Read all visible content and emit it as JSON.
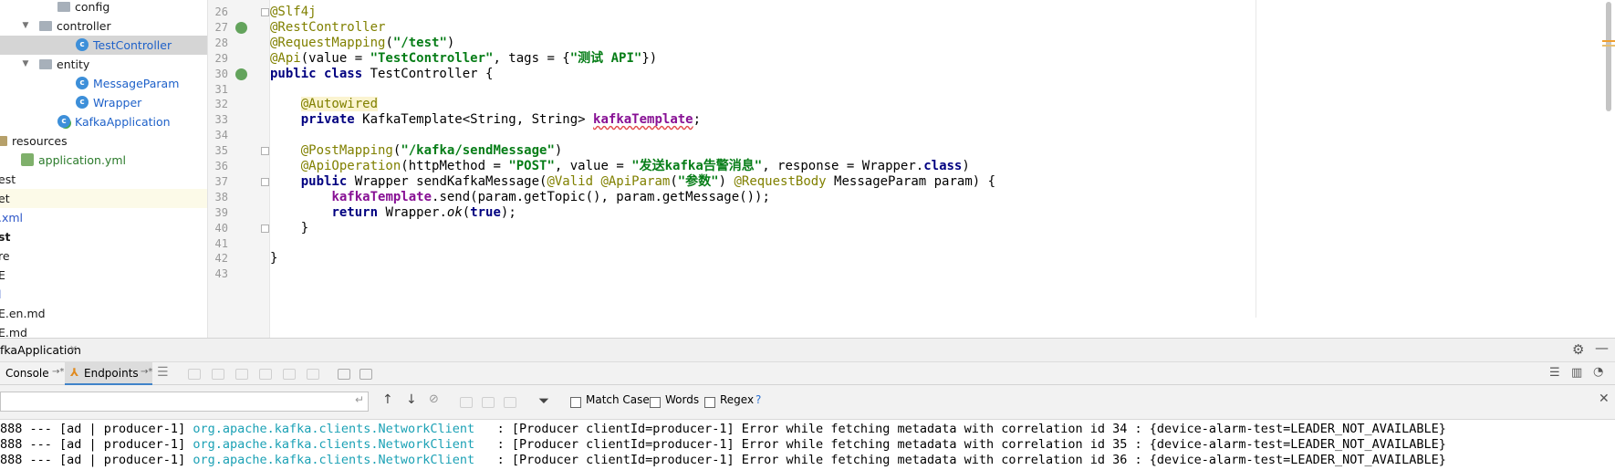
{
  "tree": [
    {
      "label": "config",
      "kind": "folder",
      "expanded": false,
      "depth": 3
    },
    {
      "label": "controller",
      "kind": "folder",
      "expanded": true,
      "depth": 2
    },
    {
      "label": "TestController",
      "kind": "class",
      "selected": true,
      "depth": 4
    },
    {
      "label": "entity",
      "kind": "folder",
      "expanded": true,
      "depth": 2
    },
    {
      "label": "MessageParam",
      "kind": "class",
      "depth": 4
    },
    {
      "label": "Wrapper",
      "kind": "class",
      "depth": 4
    },
    {
      "label": "KafkaApplication",
      "kind": "app",
      "depth": 3
    },
    {
      "label": "resources",
      "kind": "resfolder",
      "depth": 0
    },
    {
      "label": "application.yml",
      "kind": "yml",
      "depth": 1
    },
    {
      "label": "est",
      "kind": "text",
      "depth": -1
    },
    {
      "label": "et",
      "kind": "text",
      "depth": -1,
      "highlight": true
    },
    {
      "label": ".xml",
      "kind": "text",
      "depth": -1,
      "color": "blue"
    },
    {
      "label": "st",
      "kind": "text",
      "depth": -1,
      "bold": true
    },
    {
      "label": "re",
      "kind": "text",
      "depth": -1
    },
    {
      "label": "E",
      "kind": "text",
      "depth": -1
    },
    {
      "label": "l",
      "kind": "text",
      "depth": -1,
      "color": "blue"
    },
    {
      "label": "E.en.md",
      "kind": "text",
      "depth": -1
    },
    {
      "label": "E.md",
      "kind": "text",
      "depth": -1
    }
  ],
  "editor": {
    "lines": [
      {
        "n": "26",
        "fold": true,
        "tokens": [
          {
            "t": "@Slf4j",
            "c": "t-ann"
          }
        ]
      },
      {
        "n": "27",
        "icon": true,
        "tokens": [
          {
            "t": "@RestController",
            "c": "t-ann"
          }
        ]
      },
      {
        "n": "28",
        "tokens": [
          {
            "t": "@RequestMapping",
            "c": "t-ann"
          },
          {
            "t": "(",
            "c": ""
          },
          {
            "t": "\"/test\"",
            "c": "t-str"
          },
          {
            "t": ")",
            "c": ""
          }
        ]
      },
      {
        "n": "29",
        "tokens": [
          {
            "t": "@Api",
            "c": "t-ann"
          },
          {
            "t": "(value = ",
            "c": ""
          },
          {
            "t": "\"TestController\"",
            "c": "t-str"
          },
          {
            "t": ", tags = {",
            "c": ""
          },
          {
            "t": "\"测试 API\"",
            "c": "t-str"
          },
          {
            "t": "})",
            "c": ""
          }
        ]
      },
      {
        "n": "30",
        "icon": true,
        "tokens": [
          {
            "t": "public class ",
            "c": "t-kw"
          },
          {
            "t": "TestController {",
            "c": ""
          }
        ]
      },
      {
        "n": "31",
        "tokens": []
      },
      {
        "n": "32",
        "tokens": [
          {
            "t": "    ",
            "c": ""
          },
          {
            "t": "@Autowired",
            "c": "t-ann-hl"
          }
        ]
      },
      {
        "n": "33",
        "tokens": [
          {
            "t": "    ",
            "c": ""
          },
          {
            "t": "private ",
            "c": "t-kw"
          },
          {
            "t": "KafkaTemplate<String, String> ",
            "c": ""
          },
          {
            "t": "kafkaTemplate",
            "c": "t-fld"
          },
          {
            "t": ";",
            "c": ""
          }
        ]
      },
      {
        "n": "34",
        "tokens": []
      },
      {
        "n": "35",
        "fold": true,
        "tokens": [
          {
            "t": "    ",
            "c": ""
          },
          {
            "t": "@PostMapping",
            "c": "t-ann"
          },
          {
            "t": "(",
            "c": ""
          },
          {
            "t": "\"/kafka/sendMessage\"",
            "c": "t-str"
          },
          {
            "t": ")",
            "c": ""
          }
        ]
      },
      {
        "n": "36",
        "tokens": [
          {
            "t": "    ",
            "c": ""
          },
          {
            "t": "@ApiOperation",
            "c": "t-ann"
          },
          {
            "t": "(httpMethod = ",
            "c": ""
          },
          {
            "t": "\"POST\"",
            "c": "t-str"
          },
          {
            "t": ", value = ",
            "c": ""
          },
          {
            "t": "\"发送kafka告警消息\"",
            "c": "t-str"
          },
          {
            "t": ", response = Wrapper.",
            "c": ""
          },
          {
            "t": "class",
            "c": "t-kw"
          },
          {
            "t": ")",
            "c": ""
          }
        ]
      },
      {
        "n": "37",
        "fold": true,
        "tokens": [
          {
            "t": "    ",
            "c": ""
          },
          {
            "t": "public ",
            "c": "t-kw"
          },
          {
            "t": "Wrapper sendKafkaMessage(",
            "c": ""
          },
          {
            "t": "@Valid @ApiParam",
            "c": "t-ann"
          },
          {
            "t": "(",
            "c": ""
          },
          {
            "t": "\"参数\"",
            "c": "t-str"
          },
          {
            "t": ") ",
            "c": ""
          },
          {
            "t": "@RequestBody ",
            "c": "t-ann"
          },
          {
            "t": "MessageParam param) {",
            "c": ""
          }
        ]
      },
      {
        "n": "38",
        "tokens": [
          {
            "t": "        ",
            "c": ""
          },
          {
            "t": "kafkaTemplate",
            "c": "t-fld2"
          },
          {
            "t": ".send(param.getTopic(), param.getMessage());",
            "c": ""
          }
        ]
      },
      {
        "n": "39",
        "tokens": [
          {
            "t": "        ",
            "c": ""
          },
          {
            "t": "return ",
            "c": "t-kw"
          },
          {
            "t": "Wrapper.",
            "c": ""
          },
          {
            "t": "ok",
            "c": "t-it"
          },
          {
            "t": "(",
            "c": ""
          },
          {
            "t": "true",
            "c": "t-kw"
          },
          {
            "t": ");",
            "c": ""
          }
        ]
      },
      {
        "n": "40",
        "fold": true,
        "tokens": [
          {
            "t": "    }",
            "c": ""
          }
        ]
      },
      {
        "n": "41",
        "tokens": []
      },
      {
        "n": "42",
        "tokens": [
          {
            "t": "}",
            "c": ""
          }
        ]
      },
      {
        "n": "43",
        "tokens": []
      }
    ]
  },
  "run": {
    "config_name": "fkaApplication",
    "tabs": {
      "console": "Console",
      "endpoints": "Endpoints"
    },
    "search": {
      "match_case": "Match Case",
      "words": "Words",
      "regex": "Regex",
      "help": "?"
    },
    "logs": [
      {
        "prefix": "888 --- [ad | producer-1] ",
        "pkg": "org.apache.kafka.clients.NetworkClient",
        "msg": "   : [Producer clientId=producer-1] Error while fetching metadata with correlation id 34 : {device-alarm-test=LEADER_NOT_AVAILABLE}"
      },
      {
        "prefix": "888 --- [ad | producer-1] ",
        "pkg": "org.apache.kafka.clients.NetworkClient",
        "msg": "   : [Producer clientId=producer-1] Error while fetching metadata with correlation id 35 : {device-alarm-test=LEADER_NOT_AVAILABLE}"
      },
      {
        "prefix": "888 --- [ad | producer-1] ",
        "pkg": "org.apache.kafka.clients.NetworkClient",
        "msg": "   : [Producer clientId=producer-1] Error while fetching metadata with correlation id 36 : {device-alarm-test=LEADER_NOT_AVAILABLE}"
      }
    ]
  },
  "colors": {
    "selection": "#d5d5d5",
    "string": "#067d17",
    "keyword": "#000080",
    "annotation": "#808000",
    "log_package": "#1ba1b5"
  }
}
